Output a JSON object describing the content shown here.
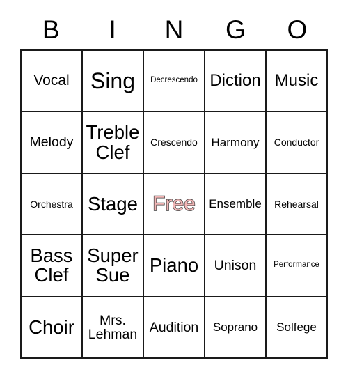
{
  "card": {
    "title": "BINGO",
    "header_letters": [
      "B",
      "I",
      "N",
      "G",
      "O"
    ],
    "free_space_color": "#f2b6b6",
    "free_space_outline_color": "#3a3a3a",
    "border_color": "#1a1a1a",
    "background_color": "#ffffff",
    "rows": [
      [
        {
          "label": "Vocal",
          "size": "lg"
        },
        {
          "label": "Sing",
          "size": "huge"
        },
        {
          "label": "Decrescendo",
          "size": "xs"
        },
        {
          "label": "Diction",
          "size": "xl"
        },
        {
          "label": "Music",
          "size": "xl"
        }
      ],
      [
        {
          "label": "Melody",
          "size": "ml"
        },
        {
          "label": "Treble Clef",
          "size": "xxl"
        },
        {
          "label": "Crescendo",
          "size": "sm"
        },
        {
          "label": "Harmony",
          "size": "md"
        },
        {
          "label": "Conductor",
          "size": "sm"
        }
      ],
      [
        {
          "label": "Orchestra",
          "size": "sm"
        },
        {
          "label": "Stage",
          "size": "xxl"
        },
        {
          "label": "Free",
          "size": "free"
        },
        {
          "label": "Ensemble",
          "size": "md"
        },
        {
          "label": "Rehearsal",
          "size": "sm"
        }
      ],
      [
        {
          "label": "Bass Clef",
          "size": "xxl"
        },
        {
          "label": "Super Sue",
          "size": "xxl"
        },
        {
          "label": "Piano",
          "size": "xxl"
        },
        {
          "label": "Unison",
          "size": "ml"
        },
        {
          "label": "Performance",
          "size": "xs"
        }
      ],
      [
        {
          "label": "Choir",
          "size": "xxl"
        },
        {
          "label": "Mrs. Lehman",
          "size": "ml"
        },
        {
          "label": "Audition",
          "size": "ml"
        },
        {
          "label": "Soprano",
          "size": "md"
        },
        {
          "label": "Solfege",
          "size": "md"
        }
      ]
    ]
  }
}
